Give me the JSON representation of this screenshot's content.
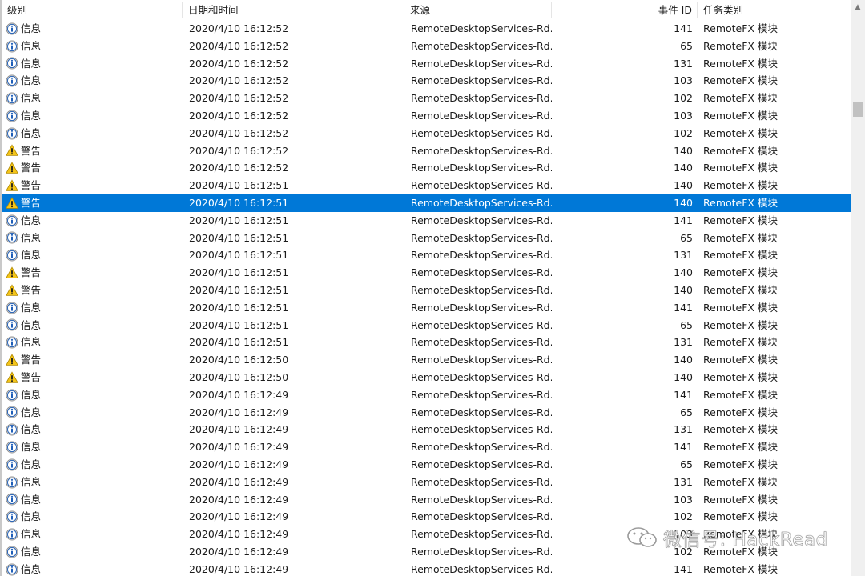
{
  "columns": {
    "level": "级别",
    "datetime": "日期和时间",
    "source": "来源",
    "event_id": "事件 ID",
    "task_category": "任务类别"
  },
  "rows": [
    {
      "level": "信息",
      "icon": "info-icon",
      "datetime": "2020/4/10 16:12:52",
      "source": "RemoteDesktopServices-Rd...",
      "event_id": "141",
      "task": "RemoteFX 模块"
    },
    {
      "level": "信息",
      "icon": "info-icon",
      "datetime": "2020/4/10 16:12:52",
      "source": "RemoteDesktopServices-Rd...",
      "event_id": "65",
      "task": "RemoteFX 模块"
    },
    {
      "level": "信息",
      "icon": "info-icon",
      "datetime": "2020/4/10 16:12:52",
      "source": "RemoteDesktopServices-Rd...",
      "event_id": "131",
      "task": "RemoteFX 模块"
    },
    {
      "level": "信息",
      "icon": "info-icon",
      "datetime": "2020/4/10 16:12:52",
      "source": "RemoteDesktopServices-Rd...",
      "event_id": "103",
      "task": "RemoteFX 模块"
    },
    {
      "level": "信息",
      "icon": "info-icon",
      "datetime": "2020/4/10 16:12:52",
      "source": "RemoteDesktopServices-Rd...",
      "event_id": "102",
      "task": "RemoteFX 模块"
    },
    {
      "level": "信息",
      "icon": "info-icon",
      "datetime": "2020/4/10 16:12:52",
      "source": "RemoteDesktopServices-Rd...",
      "event_id": "103",
      "task": "RemoteFX 模块"
    },
    {
      "level": "信息",
      "icon": "info-icon",
      "datetime": "2020/4/10 16:12:52",
      "source": "RemoteDesktopServices-Rd...",
      "event_id": "102",
      "task": "RemoteFX 模块"
    },
    {
      "level": "警告",
      "icon": "warning-icon",
      "datetime": "2020/4/10 16:12:52",
      "source": "RemoteDesktopServices-Rd...",
      "event_id": "140",
      "task": "RemoteFX 模块"
    },
    {
      "level": "警告",
      "icon": "warning-icon",
      "datetime": "2020/4/10 16:12:52",
      "source": "RemoteDesktopServices-Rd...",
      "event_id": "140",
      "task": "RemoteFX 模块"
    },
    {
      "level": "警告",
      "icon": "warning-icon",
      "datetime": "2020/4/10 16:12:51",
      "source": "RemoteDesktopServices-Rd...",
      "event_id": "140",
      "task": "RemoteFX 模块"
    },
    {
      "level": "警告",
      "icon": "warning-icon",
      "datetime": "2020/4/10 16:12:51",
      "source": "RemoteDesktopServices-Rd...",
      "event_id": "140",
      "task": "RemoteFX 模块",
      "selected": true
    },
    {
      "level": "信息",
      "icon": "info-icon",
      "datetime": "2020/4/10 16:12:51",
      "source": "RemoteDesktopServices-Rd...",
      "event_id": "141",
      "task": "RemoteFX 模块"
    },
    {
      "level": "信息",
      "icon": "info-icon",
      "datetime": "2020/4/10 16:12:51",
      "source": "RemoteDesktopServices-Rd...",
      "event_id": "65",
      "task": "RemoteFX 模块"
    },
    {
      "level": "信息",
      "icon": "info-icon",
      "datetime": "2020/4/10 16:12:51",
      "source": "RemoteDesktopServices-Rd...",
      "event_id": "131",
      "task": "RemoteFX 模块"
    },
    {
      "level": "警告",
      "icon": "warning-icon",
      "datetime": "2020/4/10 16:12:51",
      "source": "RemoteDesktopServices-Rd...",
      "event_id": "140",
      "task": "RemoteFX 模块"
    },
    {
      "level": "警告",
      "icon": "warning-icon",
      "datetime": "2020/4/10 16:12:51",
      "source": "RemoteDesktopServices-Rd...",
      "event_id": "140",
      "task": "RemoteFX 模块"
    },
    {
      "level": "信息",
      "icon": "info-icon",
      "datetime": "2020/4/10 16:12:51",
      "source": "RemoteDesktopServices-Rd...",
      "event_id": "141",
      "task": "RemoteFX 模块"
    },
    {
      "level": "信息",
      "icon": "info-icon",
      "datetime": "2020/4/10 16:12:51",
      "source": "RemoteDesktopServices-Rd...",
      "event_id": "65",
      "task": "RemoteFX 模块"
    },
    {
      "level": "信息",
      "icon": "info-icon",
      "datetime": "2020/4/10 16:12:51",
      "source": "RemoteDesktopServices-Rd...",
      "event_id": "131",
      "task": "RemoteFX 模块"
    },
    {
      "level": "警告",
      "icon": "warning-icon",
      "datetime": "2020/4/10 16:12:50",
      "source": "RemoteDesktopServices-Rd...",
      "event_id": "140",
      "task": "RemoteFX 模块"
    },
    {
      "level": "警告",
      "icon": "warning-icon",
      "datetime": "2020/4/10 16:12:50",
      "source": "RemoteDesktopServices-Rd...",
      "event_id": "140",
      "task": "RemoteFX 模块"
    },
    {
      "level": "信息",
      "icon": "info-icon",
      "datetime": "2020/4/10 16:12:49",
      "source": "RemoteDesktopServices-Rd...",
      "event_id": "141",
      "task": "RemoteFX 模块"
    },
    {
      "level": "信息",
      "icon": "info-icon",
      "datetime": "2020/4/10 16:12:49",
      "source": "RemoteDesktopServices-Rd...",
      "event_id": "65",
      "task": "RemoteFX 模块"
    },
    {
      "level": "信息",
      "icon": "info-icon",
      "datetime": "2020/4/10 16:12:49",
      "source": "RemoteDesktopServices-Rd...",
      "event_id": "131",
      "task": "RemoteFX 模块"
    },
    {
      "level": "信息",
      "icon": "info-icon",
      "datetime": "2020/4/10 16:12:49",
      "source": "RemoteDesktopServices-Rd...",
      "event_id": "141",
      "task": "RemoteFX 模块"
    },
    {
      "level": "信息",
      "icon": "info-icon",
      "datetime": "2020/4/10 16:12:49",
      "source": "RemoteDesktopServices-Rd...",
      "event_id": "65",
      "task": "RemoteFX 模块"
    },
    {
      "level": "信息",
      "icon": "info-icon",
      "datetime": "2020/4/10 16:12:49",
      "source": "RemoteDesktopServices-Rd...",
      "event_id": "131",
      "task": "RemoteFX 模块"
    },
    {
      "level": "信息",
      "icon": "info-icon",
      "datetime": "2020/4/10 16:12:49",
      "source": "RemoteDesktopServices-Rd...",
      "event_id": "103",
      "task": "RemoteFX 模块"
    },
    {
      "level": "信息",
      "icon": "info-icon",
      "datetime": "2020/4/10 16:12:49",
      "source": "RemoteDesktopServices-Rd...",
      "event_id": "102",
      "task": "RemoteFX 模块"
    },
    {
      "level": "信息",
      "icon": "info-icon",
      "datetime": "2020/4/10 16:12:49",
      "source": "RemoteDesktopServices-Rd...",
      "event_id": "103",
      "task": "RemoteFX 模块"
    },
    {
      "level": "信息",
      "icon": "info-icon",
      "datetime": "2020/4/10 16:12:49",
      "source": "RemoteDesktopServices-Rd...",
      "event_id": "102",
      "task": "RemoteFX 模块"
    },
    {
      "level": "信息",
      "icon": "info-icon",
      "datetime": "2020/4/10 16:12:49",
      "source": "RemoteDesktopServices-Rd...",
      "event_id": "141",
      "task": "RemoteFX 模块"
    }
  ],
  "watermark": {
    "text": "微信号: HackRead"
  },
  "colors": {
    "selection": "#0078d7",
    "info_icon": "#1e5eb8",
    "warning_icon": "#f5c518"
  }
}
